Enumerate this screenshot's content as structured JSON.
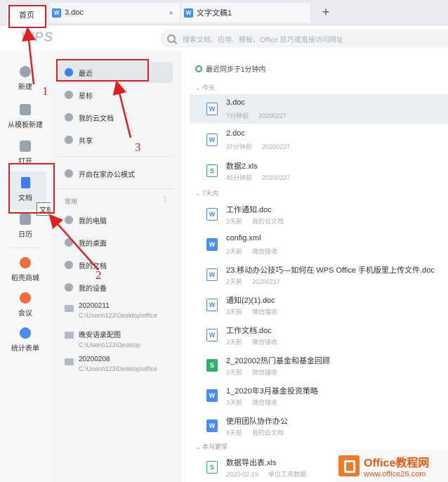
{
  "tabs": {
    "home": "首页",
    "doc1": "3.doc",
    "doc2": "文字文稿1",
    "add": "+"
  },
  "header": {
    "logo": "WPS",
    "search_placeholder": "搜索文档、应用、模板、Office 技巧或直接访问网址"
  },
  "rail": {
    "items": [
      {
        "label": "新建",
        "icon": "plus-icon"
      },
      {
        "label": "从模板新建",
        "icon": "template-icon"
      },
      {
        "label": "打开",
        "icon": "folder-open-icon"
      },
      {
        "label": "文档",
        "icon": "document-icon"
      },
      {
        "label": "日历",
        "icon": "calendar-icon"
      },
      {
        "label": "稻壳商城",
        "icon": "store-icon"
      },
      {
        "label": "会议",
        "icon": "meeting-icon"
      },
      {
        "label": "统计表单",
        "icon": "form-icon"
      }
    ],
    "tooltip": "文档"
  },
  "nav": {
    "items": [
      {
        "label": "最近",
        "icon": "clock-icon"
      },
      {
        "label": "星标",
        "icon": "star-icon"
      },
      {
        "label": "我的云文档",
        "icon": "cloud-icon"
      },
      {
        "label": "共享",
        "icon": "share-icon"
      },
      {
        "label": "开启在家办公模式",
        "icon": "home-office-icon"
      }
    ],
    "common_header": "常用",
    "more": "⋮",
    "common": [
      {
        "label": "我的电脑"
      },
      {
        "label": "我的桌面"
      },
      {
        "label": "我的文档"
      },
      {
        "label": "我的设备"
      }
    ],
    "folders": [
      {
        "name": "20200211",
        "path": "C:\\Users\\123\\Desktop\\office"
      },
      {
        "name": "晚安语录配图",
        "path": "C:\\Users\\123\\Desktop"
      },
      {
        "name": "20200208",
        "path": "C:\\Users\\123\\Desktop\\office"
      }
    ]
  },
  "list": {
    "sync": "最近同步于1分钟内",
    "sections": [
      "今天",
      "7天内",
      "本月更早"
    ],
    "files": [
      {
        "name": "3.doc",
        "time": "7分钟前",
        "loc": "20200227",
        "type": "W"
      },
      {
        "name": "2.doc",
        "time": "37分钟前",
        "loc": "20200227",
        "type": "W"
      },
      {
        "name": "数据2.xls",
        "time": "45分钟前",
        "loc": "20200227",
        "type": "S"
      },
      {
        "name": "工作通知.doc",
        "time": "2天前",
        "loc": "我的云文档",
        "type": "W"
      },
      {
        "name": "config.xml",
        "time": "2天前",
        "loc": "微信接收",
        "type": "W"
      },
      {
        "name": "23.移动办公技巧—如何在 WPS Office 手机版里上传文件.doc",
        "time": "2天前",
        "loc": "20200217",
        "type": "W"
      },
      {
        "name": "通知(2)(1).doc",
        "time": "3天前",
        "loc": "微信接收",
        "type": "W"
      },
      {
        "name": "工作文档.doc",
        "time": "3天前",
        "loc": "微信接收",
        "type": "W"
      },
      {
        "name": "2_202002热门基金和基金回顾",
        "time": "3天前",
        "loc": "微信接收",
        "type": "S"
      },
      {
        "name": "1_2020年3月基金投资策略",
        "time": "3天前",
        "loc": "微信接收",
        "type": "W"
      },
      {
        "name": "使用团队协作办公",
        "time": "6天前",
        "loc": "我的云文档",
        "type": "W"
      },
      {
        "name": "数据导出表.xls",
        "time": "2020-02-19",
        "loc": "单位工资数据",
        "type": "S"
      }
    ]
  },
  "annotations": {
    "n1": "1",
    "n2": "2",
    "n3": "3",
    "color": "#e02020"
  },
  "watermark": {
    "title": "Office教程网",
    "url": "www.office26.com"
  }
}
